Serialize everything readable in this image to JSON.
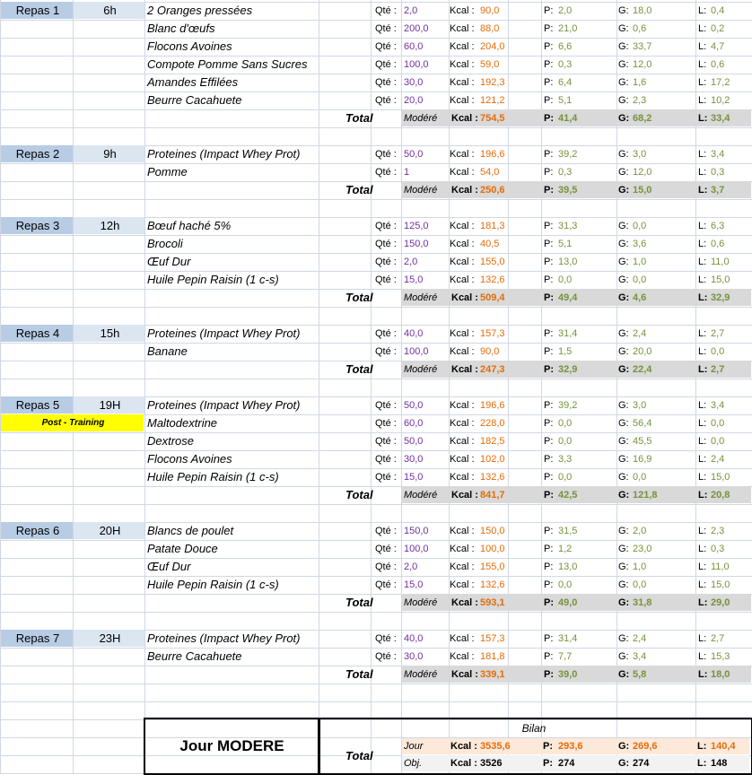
{
  "colors": {
    "repas_label_bg": "#b8cce4",
    "hour_bg": "#dce6f1",
    "total_row_bg": "#d9d9d9",
    "qty_text": "#7030a0",
    "kcal_text": "#e46c0a",
    "green_text": "#76923c",
    "post_training_bg": "#ffff00",
    "jour_row_bg": "#fde9d9",
    "obj_row_bg": "#f2f2f2",
    "gridline": "#d0d7e5"
  },
  "labels": {
    "qty": "Qté :",
    "kcal": "Kcal :",
    "p": "P:",
    "g": "G:",
    "l": "L:",
    "total": "Total",
    "modere": "Modéré"
  },
  "meals": [
    {
      "name": "Repas 1",
      "hour": "6h",
      "items": [
        {
          "food": "2 Oranges pressées",
          "qty": "2,0",
          "kcal": "90,0",
          "p": "2,0",
          "g": "18,0",
          "l": "0,4"
        },
        {
          "food": "Blanc d'œufs",
          "qty": "200,0",
          "kcal": "88,0",
          "p": "21,0",
          "g": "0,6",
          "l": "0,2"
        },
        {
          "food": "Flocons Avoines",
          "qty": "60,0",
          "kcal": "204,0",
          "p": "6,6",
          "g": "33,7",
          "l": "4,7"
        },
        {
          "food": "Compote Pomme Sans Sucres",
          "qty": "100,0",
          "kcal": "59,0",
          "p": "0,3",
          "g": "12,0",
          "l": "0,6"
        },
        {
          "food": "Amandes Effilées",
          "qty": "30,0",
          "kcal": "192,3",
          "p": "6,4",
          "g": "1,6",
          "l": "17,2"
        },
        {
          "food": "Beurre Cacahuete",
          "qty": "20,0",
          "kcal": "121,2",
          "p": "5,1",
          "g": "2,3",
          "l": "10,2"
        }
      ],
      "total": {
        "kcal": "754,5",
        "p": "41,4",
        "g": "68,2",
        "l": "33,4"
      }
    },
    {
      "name": "Repas 2",
      "hour": "9h",
      "items": [
        {
          "food": "Proteines (Impact Whey Prot)",
          "qty": "50,0",
          "kcal": "196,6",
          "p": "39,2",
          "g": "3,0",
          "l": "3,4"
        },
        {
          "food": "Pomme",
          "qty": "1",
          "kcal": "54,0",
          "p": "0,3",
          "g": "12,0",
          "l": "0,3"
        }
      ],
      "total": {
        "kcal": "250,6",
        "p": "39,5",
        "g": "15,0",
        "l": "3,7"
      }
    },
    {
      "name": "Repas 3",
      "hour": "12h",
      "items": [
        {
          "food": "Bœuf haché 5%",
          "qty": "125,0",
          "kcal": "181,3",
          "p": "31,3",
          "g": "0,0",
          "l": "6,3"
        },
        {
          "food": "Brocoli",
          "qty": "150,0",
          "kcal": "40,5",
          "p": "5,1",
          "g": "3,6",
          "l": "0,6"
        },
        {
          "food": "Œuf Dur",
          "qty": "2,0",
          "kcal": "155,0",
          "p": "13,0",
          "g": "1,0",
          "l": "11,0"
        },
        {
          "food": "Huile Pepin Raisin (1 c-s)",
          "qty": "15,0",
          "kcal": "132,6",
          "p": "0,0",
          "g": "0,0",
          "l": "15,0"
        }
      ],
      "total": {
        "kcal": "509,4",
        "p": "49,4",
        "g": "4,6",
        "l": "32,9"
      }
    },
    {
      "name": "Repas 4",
      "hour": "15h",
      "items": [
        {
          "food": "Proteines (Impact Whey Prot)",
          "qty": "40,0",
          "kcal": "157,3",
          "p": "31,4",
          "g": "2,4",
          "l": "2,7"
        },
        {
          "food": "Banane",
          "qty": "100,0",
          "kcal": "90,0",
          "p": "1,5",
          "g": "20,0",
          "l": "0,0"
        }
      ],
      "total": {
        "kcal": "247,3",
        "p": "32,9",
        "g": "22,4",
        "l": "2,7"
      }
    },
    {
      "name": "Repas 5",
      "hour": "19H",
      "tag": "Post - Training",
      "items": [
        {
          "food": "Proteines (Impact Whey Prot)",
          "qty": "50,0",
          "kcal": "196,6",
          "p": "39,2",
          "g": "3,0",
          "l": "3,4"
        },
        {
          "food": "Maltodextrine",
          "qty": "60,0",
          "kcal": "228,0",
          "p": "0,0",
          "g": "56,4",
          "l": "0,0"
        },
        {
          "food": "Dextrose",
          "qty": "50,0",
          "kcal": "182,5",
          "p": "0,0",
          "g": "45,5",
          "l": "0,0"
        },
        {
          "food": "Flocons Avoines",
          "qty": "30,0",
          "kcal": "102,0",
          "p": "3,3",
          "g": "16,9",
          "l": "2,4"
        },
        {
          "food": "Huile Pepin Raisin (1 c-s)",
          "qty": "15,0",
          "kcal": "132,6",
          "p": "0,0",
          "g": "0,0",
          "l": "15,0"
        }
      ],
      "total": {
        "kcal": "841,7",
        "p": "42,5",
        "g": "121,8",
        "l": "20,8"
      }
    },
    {
      "name": "Repas 6",
      "hour": "20H",
      "items": [
        {
          "food": "Blancs de poulet",
          "qty": "150,0",
          "kcal": "150,0",
          "p": "31,5",
          "g": "2,0",
          "l": "2,3"
        },
        {
          "food": "Patate Douce",
          "qty": "100,0",
          "kcal": "100,0",
          "p": "1,2",
          "g": "23,0",
          "l": "0,3"
        },
        {
          "food": "Œuf Dur",
          "qty": "2,0",
          "kcal": "155,0",
          "p": "13,0",
          "g": "1,0",
          "l": "11,0"
        },
        {
          "food": "Huile Pepin Raisin (1 c-s)",
          "qty": "15,0",
          "kcal": "132,6",
          "p": "0,0",
          "g": "0,0",
          "l": "15,0"
        }
      ],
      "total": {
        "kcal": "593,1",
        "p": "49,0",
        "g": "31,8",
        "l": "29,0"
      }
    },
    {
      "name": "Repas 7",
      "hour": "23H",
      "items": [
        {
          "food": "Proteines (Impact Whey Prot)",
          "qty": "40,0",
          "kcal": "157,3",
          "p": "31,4",
          "g": "2,4",
          "l": "2,7"
        },
        {
          "food": "Beurre Cacahuete",
          "qty": "30,0",
          "kcal": "181,8",
          "p": "7,7",
          "g": "3,4",
          "l": "15,3"
        }
      ],
      "total": {
        "kcal": "339,1",
        "p": "39,0",
        "g": "5,8",
        "l": "18,0"
      }
    }
  ],
  "bilan": {
    "title": "Jour MODERE",
    "header": "Bilan",
    "total_label": "Total",
    "jour": {
      "label": "Jour",
      "kcal": "3535,6",
      "p": "293,6",
      "g": "269,6",
      "l": "140,4"
    },
    "obj": {
      "label": "Obj.",
      "kcal": "3526",
      "p": "274",
      "g": "274",
      "l": "148"
    }
  }
}
